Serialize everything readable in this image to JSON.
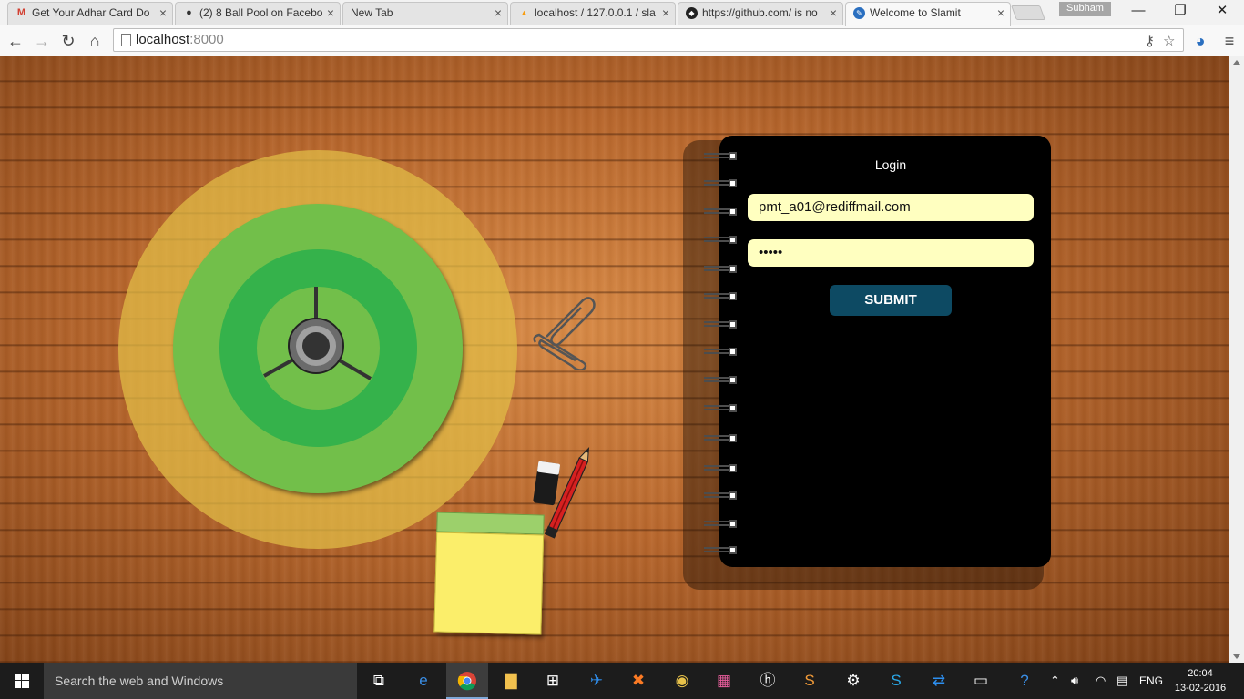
{
  "browser": {
    "tabs": [
      {
        "title": "Get Your Adhar Card Do",
        "icon": "gmail-icon",
        "active": false
      },
      {
        "title": "(2) 8 Ball Pool on Facebo",
        "icon": "8ball-icon",
        "active": false
      },
      {
        "title": "New Tab",
        "icon": "",
        "active": false
      },
      {
        "title": "localhost / 127.0.0.1 / sla",
        "icon": "phpmyadmin-icon",
        "active": false
      },
      {
        "title": "https://github.com/ is no",
        "icon": "github-icon",
        "active": false
      },
      {
        "title": "Welcome to Slamit",
        "icon": "slamit-icon",
        "active": true
      }
    ],
    "profile_name": "Subham",
    "address": {
      "host": "localhost",
      "port": ":8000"
    }
  },
  "login": {
    "title": "Login",
    "email_value": "pmt_a01@rediffmail.com",
    "password_value": "•••••",
    "submit_label": "SUBMIT"
  },
  "taskbar": {
    "search_placeholder": "Search the web and Windows",
    "language": "ENG",
    "time": "20:04",
    "date": "13-02-2016"
  },
  "colors": {
    "accent": "#0d4a63",
    "input_bg": "#ffffc0",
    "disc_light": "#72bf4a",
    "disc_dark": "#35b24b"
  }
}
